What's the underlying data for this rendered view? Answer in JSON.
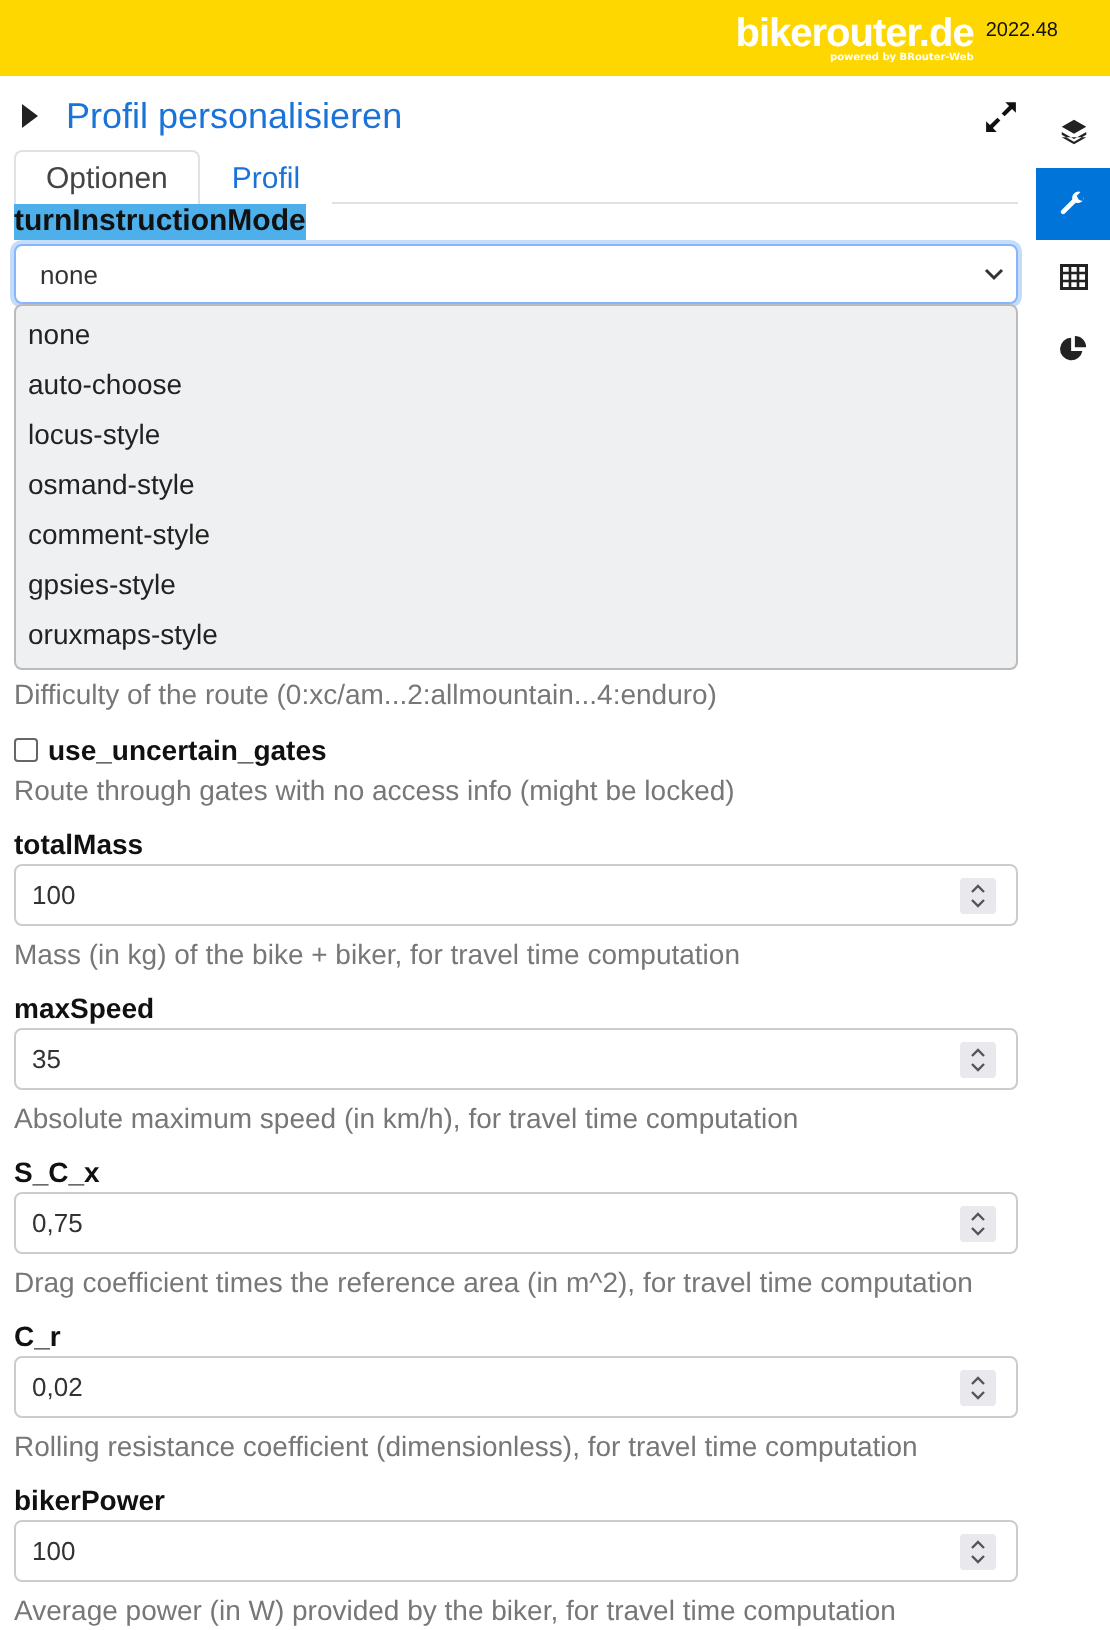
{
  "header": {
    "logo": "bikerouter.de",
    "logo_tagline": "powered by BRouter-Web",
    "version": "2022.48"
  },
  "panel": {
    "title": "Profil personalisieren",
    "expanded": true
  },
  "tabs": [
    {
      "label": "Optionen",
      "selected": true
    },
    {
      "label": "Profil",
      "selected": false
    }
  ],
  "sidebar": [
    {
      "kind": "layers",
      "selected": false
    },
    {
      "kind": "wrench",
      "selected": true
    },
    {
      "kind": "table",
      "selected": false
    },
    {
      "kind": "pie",
      "selected": false
    }
  ],
  "select_field": {
    "label": "turnInstructionMode",
    "value": "none",
    "options": [
      {
        "label": "none"
      },
      {
        "label": "auto-choose"
      },
      {
        "label": "locus-style"
      },
      {
        "label": "osmand-style"
      },
      {
        "label": "comment-style"
      },
      {
        "label": "gpsies-style"
      },
      {
        "label": "oruxmaps-style"
      }
    ]
  },
  "fields": [
    {
      "kind": "hint",
      "hint": "Difficulty of the route (0:xc/am...2:allmountain...4:enduro)"
    },
    {
      "kind": "checkbox",
      "label": "use_uncertain_gates",
      "checked": false,
      "hint": "Route through gates with no access info (might be locked)"
    },
    {
      "kind": "number",
      "label": "totalMass",
      "value": "100",
      "hint": "Mass (in kg) of the bike + biker, for travel time computation"
    },
    {
      "kind": "number",
      "label": "maxSpeed",
      "value": "35",
      "hint": "Absolute maximum speed (in km/h), for travel time computation"
    },
    {
      "kind": "number",
      "label": "S_C_x",
      "value": "0,75",
      "hint": "Drag coefficient times the reference area (in m^2), for travel time computation"
    },
    {
      "kind": "number",
      "label": "C_r",
      "value": "0,02",
      "hint": "Rolling resistance coefficient (dimensionless), for travel time computation"
    },
    {
      "kind": "number",
      "label": "bikerPower",
      "value": "100",
      "hint": "Average power (in W) provided by the biker, for travel time computation"
    }
  ]
}
